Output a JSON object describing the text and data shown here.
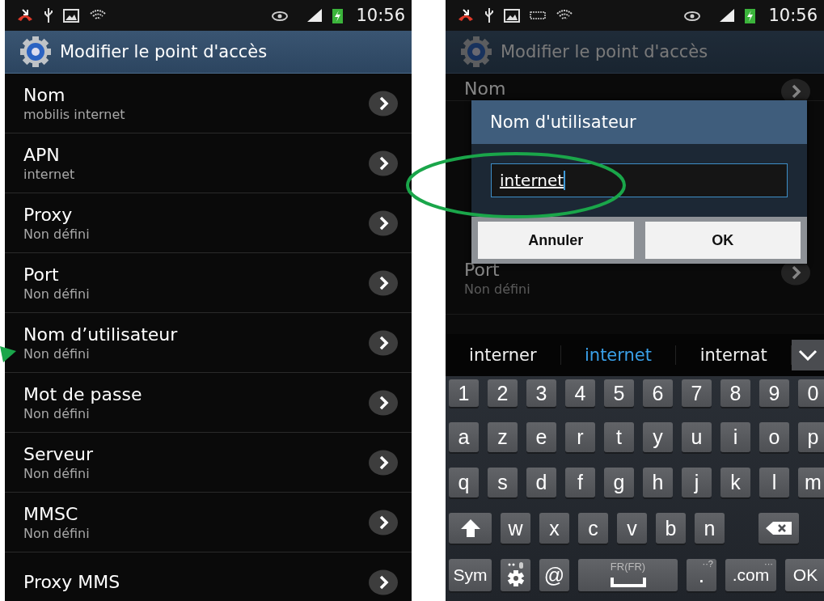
{
  "left_screen": {
    "status_bar": {
      "time": "10:56"
    },
    "header": {
      "title": "Modifier le point d'accès"
    },
    "rows": [
      {
        "title": "Nom",
        "subtitle": "mobilis internet"
      },
      {
        "title": "APN",
        "subtitle": "internet"
      },
      {
        "title": "Proxy",
        "subtitle": "Non défini"
      },
      {
        "title": "Port",
        "subtitle": "Non défini"
      },
      {
        "title": "Nom d’utilisateur",
        "subtitle": "Non défini"
      },
      {
        "title": "Mot de passe",
        "subtitle": "Non défini"
      },
      {
        "title": "Serveur",
        "subtitle": "Non défini"
      },
      {
        "title": "MMSC",
        "subtitle": "Non défini"
      },
      {
        "title": "Proxy MMS"
      }
    ]
  },
  "right_screen": {
    "status_bar": {
      "time": "10:56"
    },
    "header": {
      "title": "Modifier le point d'accès"
    },
    "background_rows": [
      {
        "title": "Nom"
      },
      {
        "title": "Port",
        "subtitle": "Non défini"
      }
    ],
    "dialog": {
      "title": "Nom d'utilisateur",
      "value": "internet",
      "buttons": [
        "Annuler",
        "OK"
      ]
    },
    "keyboard": {
      "suggestions": [
        {
          "text": "interner",
          "selected": false
        },
        {
          "text": "internet",
          "selected": true
        },
        {
          "text": "internat",
          "selected": false
        }
      ],
      "rows": [
        {
          "keys": [
            {
              "kind": "char",
              "label": "1"
            },
            {
              "kind": "char",
              "label": "2"
            },
            {
              "kind": "char",
              "label": "3"
            },
            {
              "kind": "char",
              "label": "4"
            },
            {
              "kind": "char",
              "label": "5"
            },
            {
              "kind": "char",
              "label": "6"
            },
            {
              "kind": "char",
              "label": "7"
            },
            {
              "kind": "char",
              "label": "8"
            },
            {
              "kind": "char",
              "label": "9"
            },
            {
              "kind": "char",
              "label": "0"
            }
          ]
        },
        {
          "keys": [
            {
              "kind": "char",
              "label": "a"
            },
            {
              "kind": "char",
              "label": "z"
            },
            {
              "kind": "char",
              "label": "e"
            },
            {
              "kind": "char",
              "label": "r"
            },
            {
              "kind": "char",
              "label": "t"
            },
            {
              "kind": "char",
              "label": "y"
            },
            {
              "kind": "char",
              "label": "u"
            },
            {
              "kind": "char",
              "label": "i"
            },
            {
              "kind": "char",
              "label": "o"
            },
            {
              "kind": "char",
              "label": "p"
            }
          ]
        },
        {
          "keys": [
            {
              "kind": "char",
              "label": "q"
            },
            {
              "kind": "char",
              "label": "s"
            },
            {
              "kind": "char",
              "label": "d"
            },
            {
              "kind": "char",
              "label": "f"
            },
            {
              "kind": "char",
              "label": "g"
            },
            {
              "kind": "char",
              "label": "h"
            },
            {
              "kind": "char",
              "label": "j"
            },
            {
              "kind": "char",
              "label": "k"
            },
            {
              "kind": "char",
              "label": "l"
            },
            {
              "kind": "char",
              "label": "m"
            }
          ]
        },
        {
          "keys": [
            {
              "kind": "shift"
            },
            {
              "kind": "char",
              "label": "w"
            },
            {
              "kind": "char",
              "label": "x"
            },
            {
              "kind": "char",
              "label": "c"
            },
            {
              "kind": "char",
              "label": "v"
            },
            {
              "kind": "char",
              "label": "b"
            },
            {
              "kind": "char",
              "label": "n"
            },
            {
              "kind": "delete"
            }
          ]
        },
        {
          "keys": [
            {
              "kind": "wide",
              "label": "Sym"
            },
            {
              "kind": "settings"
            },
            {
              "kind": "char",
              "label": "@"
            },
            {
              "kind": "space",
              "label": "FR(FR)"
            },
            {
              "kind": "hint",
              "label": ".",
              "hint": "··?"
            },
            {
              "kind": "com",
              "label": ".com",
              "hint": "···"
            },
            {
              "kind": "wide",
              "label": "OK"
            }
          ]
        }
      ]
    }
  }
}
